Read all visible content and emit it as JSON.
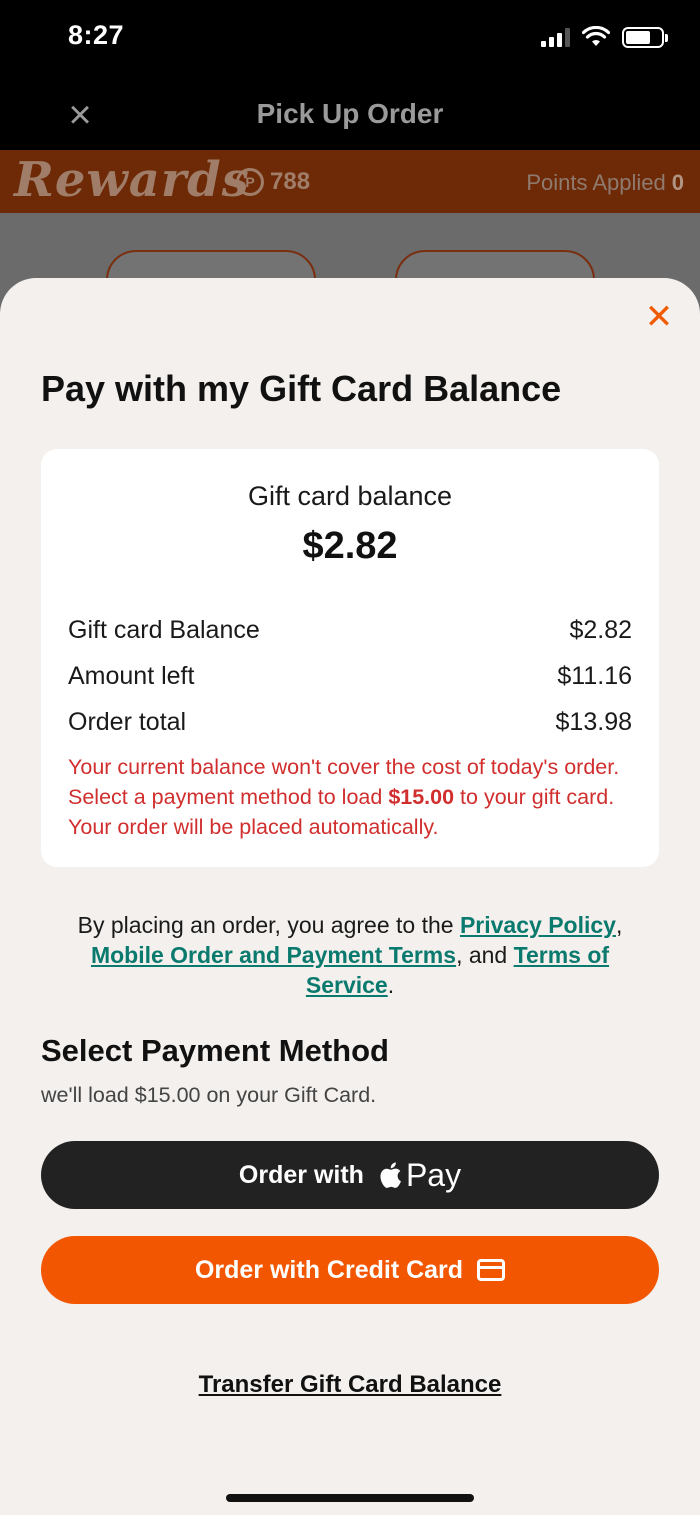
{
  "status_bar": {
    "time": "8:27"
  },
  "header": {
    "title": "Pick Up Order"
  },
  "rewards": {
    "logo_text": "Rewards",
    "points": "788",
    "points_applied_label": "Points Applied",
    "points_applied_value": "0"
  },
  "sheet": {
    "title": "Pay with my Gift Card Balance",
    "balance_card": {
      "label": "Gift card balance",
      "amount": "$2.82",
      "rows": [
        {
          "label": "Gift card Balance",
          "value": "$2.82"
        },
        {
          "label": "Amount left",
          "value": "$11.16"
        },
        {
          "label": "Order total",
          "value": "$13.98"
        }
      ],
      "warning_part1": "Your current balance won't cover the cost of today's order. Select a payment method to load ",
      "warning_amount": "$15.00",
      "warning_part2": " to your gift card. Your order will be placed automatically."
    },
    "legal": {
      "prefix": "By placing an order, you agree to the ",
      "privacy_link": "Privacy Policy",
      "sep1": ", ",
      "mobile_terms_link": "Mobile Order and Payment Terms",
      "sep2": ", and ",
      "tos_link": "Terms of Service",
      "suffix": "."
    },
    "payment": {
      "title": "Select Payment Method",
      "subtitle": "we'll load $15.00 on your Gift Card.",
      "apple_pay_label": "Order with",
      "apple_pay_brand": "Pay",
      "credit_card_label": "Order with Credit Card"
    },
    "transfer_link": "Transfer Gift Card Balance"
  },
  "colors": {
    "accent": "#f25600",
    "link": "#0b7a6e",
    "warning": "#d12e2e",
    "rewards_bar": "#6e2a07"
  }
}
